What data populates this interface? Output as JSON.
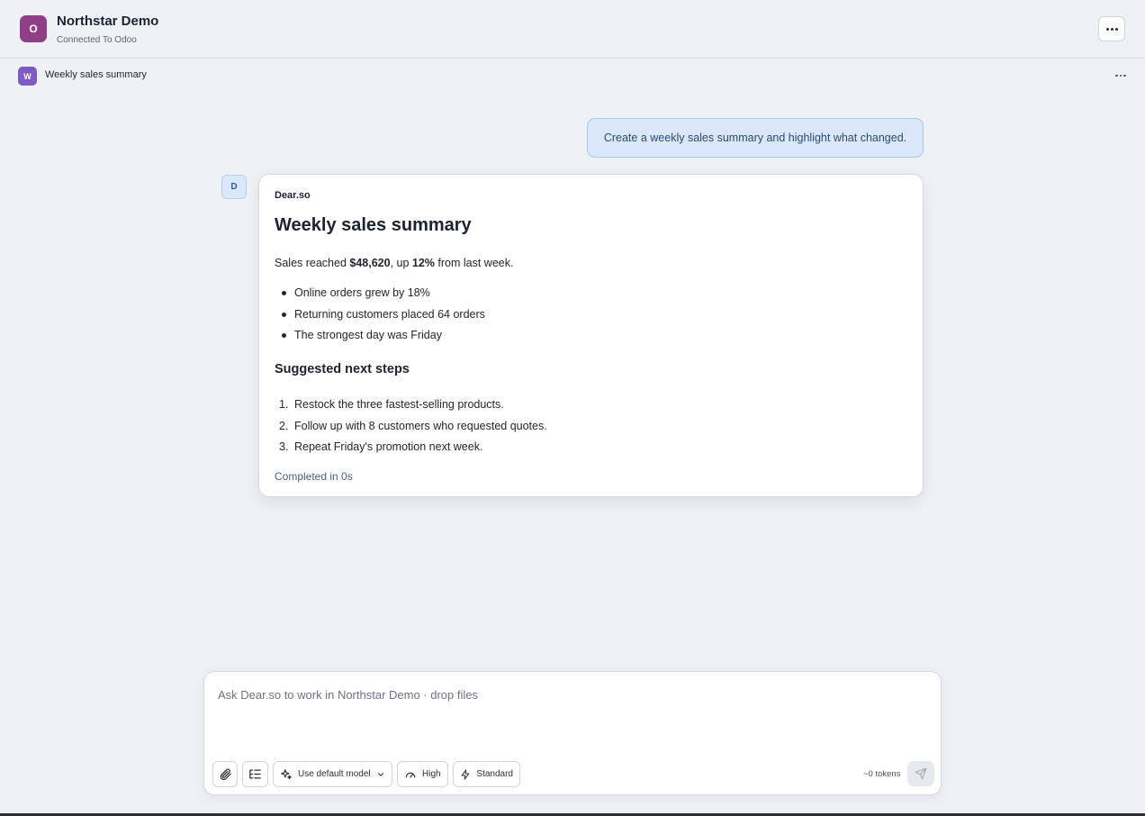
{
  "workspace": {
    "initial": "O",
    "title": "Northstar Demo",
    "subtitle": "Connected To Odoo"
  },
  "chat": {
    "initial": "W",
    "title": "Weekly sales summary"
  },
  "user_message": "Create a weekly sales summary and highlight what changed.",
  "assistant": {
    "initial": "D",
    "name": "Dear.so",
    "heading": "Weekly sales summary",
    "summary": {
      "prefix": "Sales reached ",
      "amount": "$48,620",
      "middle": ", up ",
      "percent": "12%",
      "suffix": " from last week."
    },
    "bullets": [
      "Online orders grew by 18%",
      "Returning customers placed 64 orders",
      "The strongest day was Friday"
    ],
    "steps_heading": "Suggested next steps",
    "steps": [
      {
        "num": "1.",
        "text": "Restock the three fastest-selling products."
      },
      {
        "num": "2.",
        "text": "Follow up with 8 customers who requested quotes."
      },
      {
        "num": "3.",
        "text": "Repeat Friday's promotion next week."
      }
    ],
    "status": "Completed in 0s"
  },
  "composer": {
    "placeholder": "Ask Dear.so to work in Northstar Demo · drop files",
    "model_label": "Use default model",
    "effort_label": "High",
    "speed_label": "Standard",
    "tokens": "~0 tokens"
  },
  "icons": {
    "attach": "paperclip-icon",
    "outline": "list-outline-icon",
    "model": "sparkle-icon",
    "effort": "gauge-icon",
    "speed": "lightning-icon",
    "send": "send-icon",
    "menu": "more-horizontal-icon"
  },
  "colors": {
    "background": "#eef1f6",
    "workspace_avatar": "#8e3f86",
    "chat_avatar": "#7e5bc4",
    "user_bubble": "#dbe8fb",
    "user_bubble_border": "#a9c6ee",
    "user_text": "#2b4a78"
  }
}
